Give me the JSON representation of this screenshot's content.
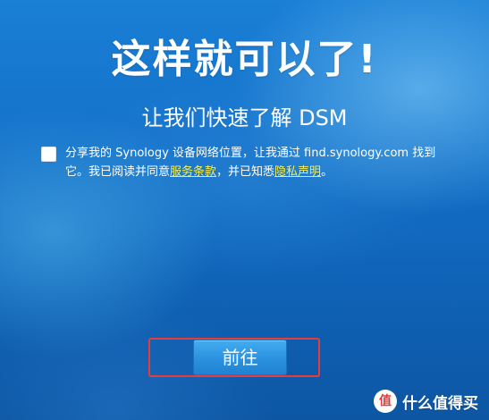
{
  "headline": "这样就可以了!",
  "subheadline": "让我们快速了解 DSM",
  "consent": {
    "checked": false,
    "text_before": "分享我的 Synology 设备网络位置，让我通过 find.synology.com 找到它。我已阅读并同意",
    "terms_link": "服务条款",
    "text_middle": "，并已知悉",
    "privacy_link": "隐私声明",
    "text_after": "。"
  },
  "go_button": "前往",
  "watermark": {
    "logo": "值",
    "text": "什么值得买"
  },
  "colors": {
    "link": "#f6ee4d",
    "button": "#2b92df",
    "highlight_frame": "#e83b3b"
  },
  "icons": {
    "checkbox": "checkbox-unchecked"
  }
}
